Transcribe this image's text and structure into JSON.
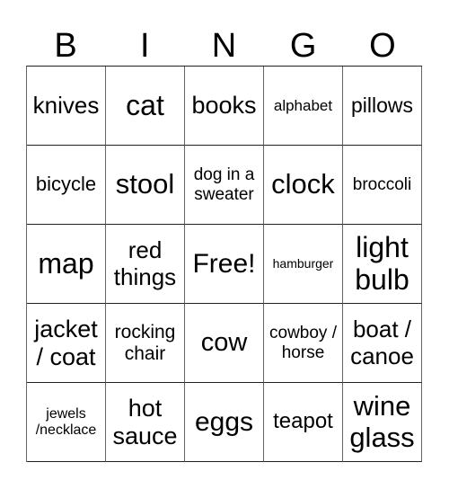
{
  "header": {
    "letters": [
      "B",
      "I",
      "N",
      "G",
      "O"
    ]
  },
  "cells": [
    [
      "knives",
      "cat",
      "books",
      "alphabet",
      "pillows"
    ],
    [
      "bicycle",
      "stool",
      "dog in a sweater",
      "clock",
      "broccoli"
    ],
    [
      "map",
      "red things",
      "Free!",
      "hamburger",
      "light bulb"
    ],
    [
      "jacket / coat",
      "rocking chair",
      "cow",
      "cowboy / horse",
      "boat / canoe"
    ],
    [
      "jewels /necklace",
      "hot sauce",
      "eggs",
      "teapot",
      "wine glass"
    ]
  ]
}
